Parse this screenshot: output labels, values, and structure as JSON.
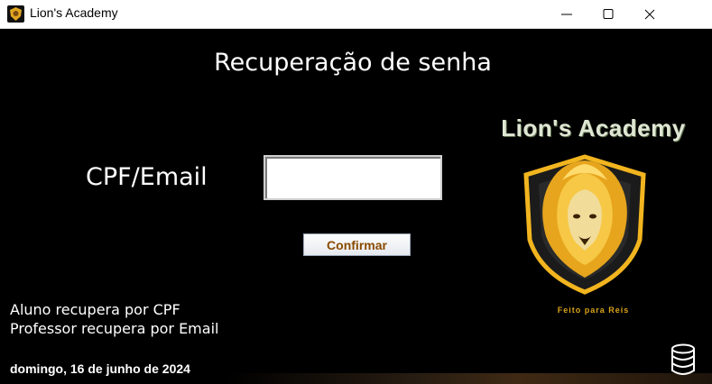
{
  "window": {
    "title": "Lion's Academy",
    "controls": {
      "minimize": "minimize-icon",
      "maximize": "maximize-icon",
      "close": "close-icon"
    }
  },
  "form": {
    "heading": "Recuperação de senha",
    "field_label": "CPF/Email",
    "field_value": "",
    "confirm_label": "Confirmar"
  },
  "hints": {
    "line1": "Aluno recupera por CPF",
    "line2": "Professor recupera por Email"
  },
  "status": {
    "date": "domingo, 16 de junho de 2024"
  },
  "brand": {
    "name": "Lion's Academy",
    "tagline": "Feito para Reis",
    "logo_icon": "lion-crest-icon",
    "colors": {
      "gold": "#f2b51f",
      "shield_edge": "#2f2f2f",
      "name": "#dfe7d4"
    }
  },
  "database_icon": "database-icon"
}
